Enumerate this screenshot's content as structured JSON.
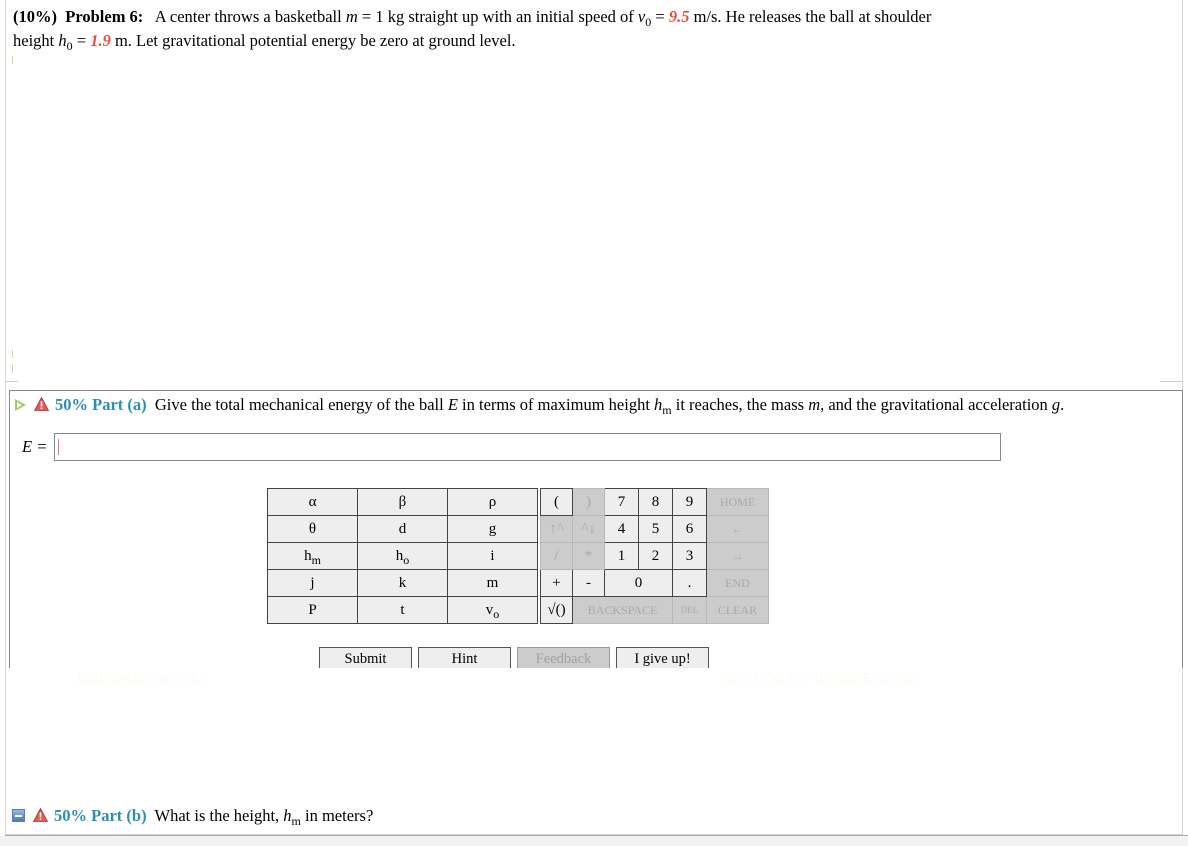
{
  "problem": {
    "weight": "(10%)",
    "title": "Problem 6:",
    "text_1": "A center throws a basketball",
    "mass_sym": "m",
    "mass_eq": " = 1 kg straight up with an initial speed of ",
    "v0_sym": "v",
    "v0_sub": "0",
    "v0_eq": " = ",
    "v0_val": "9.5",
    "v0_unit": " m/s. He releases the ball at shoulder",
    "text_2": "height ",
    "h0_sym": "h",
    "h0_sub": "0",
    "h0_eq": " = ",
    "h0_val": "1.9",
    "text_3": " m. Let gravitational potential energy be zero at ground level."
  },
  "part_a": {
    "percent": "50% Part (a)",
    "q_1": "Give the total mechanical energy of the ball ",
    "E_sym": "E",
    "q_2": " in terms of maximum height ",
    "hm_sym": "h",
    "hm_sub": "m",
    "q_3": " it reaches, the mass ",
    "m_sym": "m",
    "q_4": ", and the gravitational acceleration ",
    "g_sym": "g",
    "q_5": ".",
    "answer_label": "E = ",
    "answer_value": ""
  },
  "keypad": {
    "vars": [
      [
        "α",
        "β",
        "ρ"
      ],
      [
        "θ",
        "d",
        "g"
      ],
      [
        {
          "b": "h",
          "s": "m"
        },
        {
          "b": "h",
          "s": "o"
        },
        "i"
      ],
      [
        "j",
        "k",
        "m"
      ],
      [
        "P",
        "t",
        {
          "b": "v",
          "s": "o"
        }
      ]
    ],
    "ops": {
      "open_paren": "(",
      "close_paren": ")",
      "n7": "7",
      "n8": "8",
      "n9": "9",
      "home": "HOME",
      "up_caret": "↑^",
      "caret_down": "^↓",
      "n4": "4",
      "n5": "5",
      "n6": "6",
      "left": "←",
      "divide": "/",
      "multiply": "*",
      "n1": "1",
      "n2": "2",
      "n3": "3",
      "right": "→",
      "plus": "+",
      "minus": "-",
      "n0": "0",
      "dot": ".",
      "end": "END",
      "sqrt": "√()",
      "backspace": "BACKSPACE",
      "del": "DEL",
      "clear": "CLEAR"
    }
  },
  "buttons": {
    "submit": "Submit",
    "hint": "Hint",
    "feedback": "Feedback",
    "give_up": "I give up!"
  },
  "watermark": {
    "left": "bbunzel@cnm.edu",
    "right": "3N77-D6-F8-4D-89DE-25769"
  },
  "part_b": {
    "percent": "50% Part (b)",
    "q_1": "What is the height, ",
    "hm_sym": "h",
    "hm_sub": "m",
    "q_2": " in meters?"
  },
  "colors": {
    "accent": "#2a8fb0",
    "given_value": "#e8503a",
    "disabled_key": "#cccccc",
    "key": "#eeeeee"
  }
}
